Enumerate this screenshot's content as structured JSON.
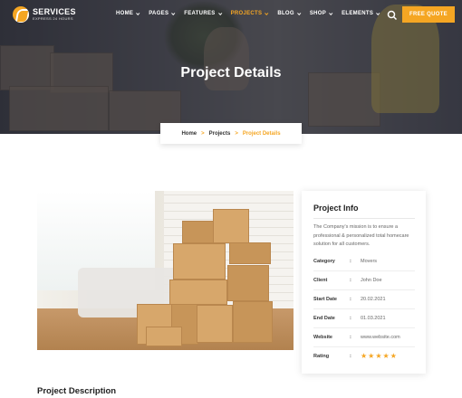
{
  "brand": {
    "name": "SERVICES",
    "tagline": "EXPRESS 24 HOURS"
  },
  "menu": [
    {
      "label": "HOME",
      "active": false
    },
    {
      "label": "PAGES",
      "active": false
    },
    {
      "label": "FEATURES",
      "active": false
    },
    {
      "label": "PROJECTS",
      "active": true
    },
    {
      "label": "BLOG",
      "active": false
    },
    {
      "label": "SHOP",
      "active": false
    },
    {
      "label": "ELEMENTS",
      "active": false
    }
  ],
  "cta_label": "FREE QUOTE",
  "page_title": "Project Details",
  "breadcrumb": {
    "home": "Home",
    "middle": "Projects",
    "current": "Project Details",
    "separator": ">"
  },
  "project_info": {
    "title": "Project Info",
    "description": "The Company's mission is to ensure a professional & personalized total homecare solution for all customers.",
    "rows": [
      {
        "label": "Category",
        "value": "Movers"
      },
      {
        "label": "Client",
        "value": "John Doe"
      },
      {
        "label": "Start Date",
        "value": "20.02.2021"
      },
      {
        "label": "End Date",
        "value": "01.03.2021"
      },
      {
        "label": "Website",
        "value": "www.website.com"
      }
    ],
    "rating_label": "Rating",
    "rating": 5,
    "rating_max": 5,
    "colon": ":"
  },
  "section_title": "Project Description",
  "colors": {
    "accent": "#f5a623",
    "text": "#222222",
    "muted": "#666666"
  },
  "icons": {
    "search": "search-icon",
    "star": "star-icon",
    "logo": "logo-icon"
  }
}
